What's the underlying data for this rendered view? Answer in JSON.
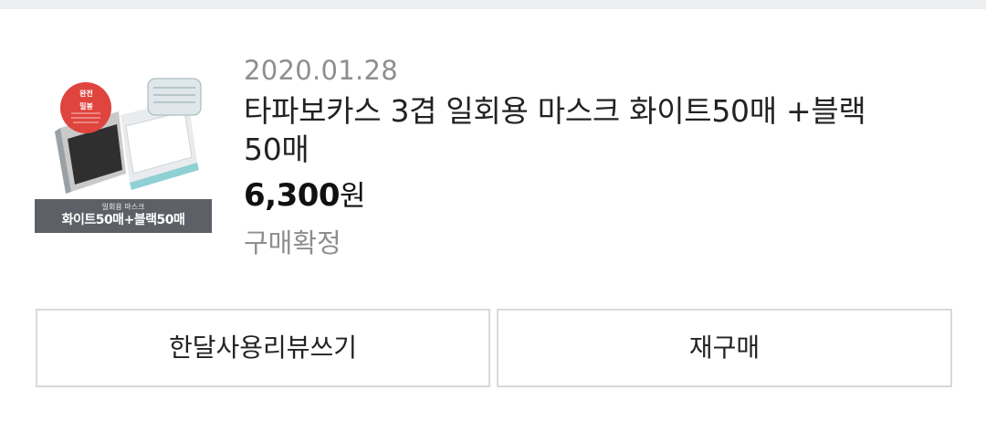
{
  "order": {
    "date": "2020.01.28",
    "product_name": "타파보카스 3겹 일회용 마스크 화이트50매 +블랙50매",
    "price": "6,300",
    "currency": "원",
    "status": "구매확정",
    "thumbnail": {
      "badge": "완전밀봉",
      "banner_sub": "일회용 마스크",
      "banner_main": "화이트50매+블랙50매"
    }
  },
  "actions": {
    "review_label": "한달사용리뷰쓰기",
    "reorder_label": "재구매"
  }
}
